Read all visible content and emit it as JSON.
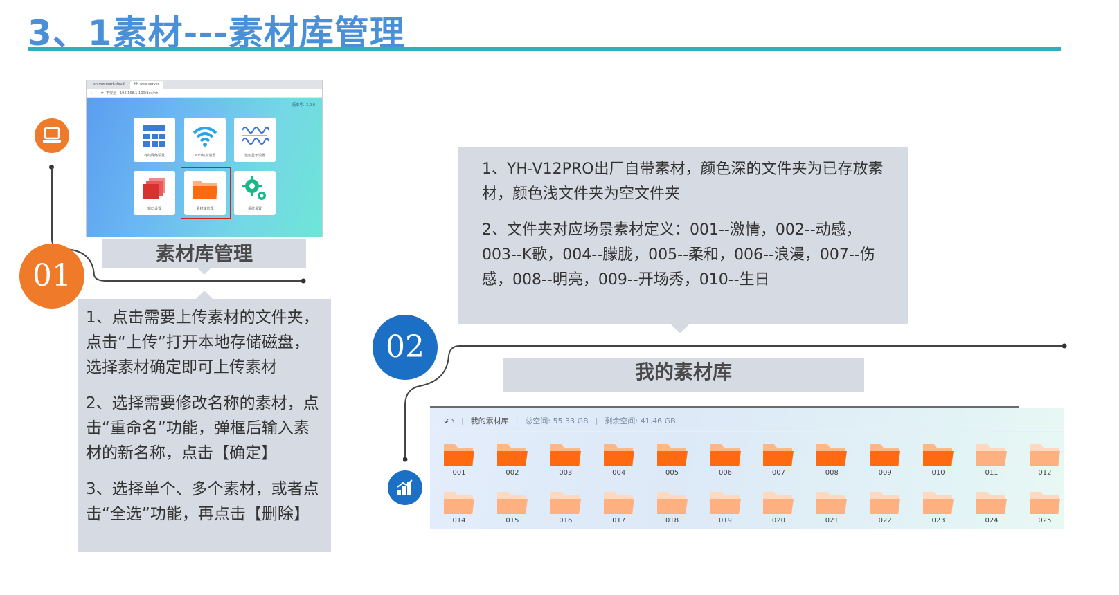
{
  "title": "3、1素材---素材库管理",
  "browser": {
    "tabs": [
      "cn.mzsmart.cloud",
      "hh-web-server"
    ],
    "address_secure": "不安全",
    "address_url": "192.168.1.100/dev/hh",
    "version": "版本号：2.0.0",
    "tiles": [
      {
        "label": "有线网络设置",
        "icon": "network-icon"
      },
      {
        "label": "WIFI热点设置",
        "icon": "wifi-icon"
      },
      {
        "label": "波形显示设置",
        "icon": "wave-icon"
      },
      {
        "label": "窗口设置",
        "icon": "windows-icon"
      },
      {
        "label": "素材库管理",
        "icon": "folder-icon"
      },
      {
        "label": "系统设置",
        "icon": "gear-icon"
      }
    ]
  },
  "section1": {
    "number": "01",
    "caption": "素材库管理",
    "paragraphs": [
      "1、点击需要上传素材的文件夹，点击“上传”打开本地存储磁盘，选择素材确定即可上传素材",
      "2、选择需要修改名称的素材，点击“重命名”功能，弹框后输入素材的新名称，点击【确定】",
      "3、选择单个、多个素材，或者点击“全选”功能，再点击【删除】"
    ]
  },
  "section2": {
    "number": "02",
    "caption": "我的素材库",
    "paragraphs": [
      "1、YH-V12PRO出厂自带素材，颜色深的文件夹为已存放素材，颜色浅文件夹为空文件夹",
      "2、文件夹对应场景素材定义：001--激情，002--动感，003--K歌，004--朦胧，005--柔和，006--浪漫，007--伤感，008--明亮，009--开场秀，010--生日"
    ]
  },
  "library": {
    "breadcrumb": "我的素材库",
    "total_label": "总空间:",
    "total_value": "55.33 GB",
    "free_label": "剩余空间:",
    "free_value": "41.46 GB",
    "folders_row1": [
      {
        "name": "001",
        "filled": true
      },
      {
        "name": "002",
        "filled": true
      },
      {
        "name": "003",
        "filled": true
      },
      {
        "name": "004",
        "filled": true
      },
      {
        "name": "005",
        "filled": true
      },
      {
        "name": "006",
        "filled": true
      },
      {
        "name": "007",
        "filled": true
      },
      {
        "name": "008",
        "filled": true
      },
      {
        "name": "009",
        "filled": true
      },
      {
        "name": "010",
        "filled": true
      },
      {
        "name": "011",
        "filled": false
      },
      {
        "name": "012",
        "filled": false
      }
    ],
    "folders_row2": [
      {
        "name": "014",
        "filled": false
      },
      {
        "name": "015",
        "filled": false
      },
      {
        "name": "016",
        "filled": false
      },
      {
        "name": "017",
        "filled": false
      },
      {
        "name": "018",
        "filled": false
      },
      {
        "name": "019",
        "filled": false
      },
      {
        "name": "020",
        "filled": false
      },
      {
        "name": "021",
        "filled": false
      },
      {
        "name": "022",
        "filled": false
      },
      {
        "name": "023",
        "filled": false
      },
      {
        "name": "024",
        "filled": false
      },
      {
        "name": "025",
        "filled": false
      }
    ]
  },
  "colors": {
    "title": "#4a90d8",
    "rule": "#2bb0c0",
    "orange": "#ef7a2a",
    "blue": "#1b6fc4",
    "folder_filled": "#ff6a10",
    "folder_empty": "#ffb080"
  }
}
